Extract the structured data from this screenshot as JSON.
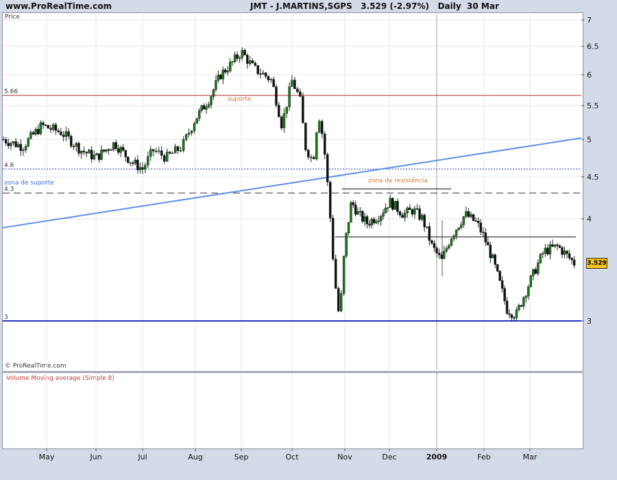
{
  "header": {
    "site": "www.ProRealTime.com",
    "symbol": "JMT - J.MARTINS,SGPS",
    "last_price": "3.529",
    "change": "(-2.97%)",
    "period": "Daily",
    "date": "30 Mar"
  },
  "panel": {
    "price_label": "Price",
    "copyright": "© ProRealTime.com",
    "volume_label": "Volume Moving average (Simple 8)"
  },
  "colors": {
    "up": "#1a7a1a",
    "down": "#111111",
    "support_red": "#b22222",
    "trendline": "#5b8fe8",
    "base_line": "#2233bb",
    "annotation_orange": "#d4782a",
    "annotation_blue": "#3c6fd9",
    "price_box": "#f2c21a"
  },
  "chart_data": {
    "type": "candlestick",
    "y_axis": {
      "ticks": [
        7,
        6.5,
        6,
        5.5,
        5,
        4.5,
        4,
        3
      ],
      "tick_labels": [
        "7",
        "6.5",
        "6",
        "5.5",
        "5",
        "4.5",
        "4",
        "3"
      ],
      "range": [
        2.6,
        7.1
      ],
      "scale": "log"
    },
    "x_axis": {
      "labels": [
        "May",
        "Jun",
        "Jul",
        "Aug",
        "Sep",
        "Oct",
        "Nov",
        "Dec",
        "2009",
        "Feb",
        "Mar"
      ],
      "range": [
        "2008-05",
        "2009-03"
      ]
    },
    "current_price_label": "3.529",
    "series": [
      {
        "x": [
          "2008-04",
          "2008-05",
          "2008-06",
          "2008-07",
          "2008-08",
          "2008-09",
          "2008-10",
          "2008-10b",
          "2008-11",
          "2008-12",
          "2009-01",
          "2009-02",
          "2009-03"
        ],
        "values": [
          4.95,
          5.15,
          4.7,
          4.6,
          5.55,
          6.3,
          5.8,
          3.2,
          3.95,
          4.05,
          3.6,
          3.05,
          3.6
        ]
      }
    ],
    "horizontal_lines": [
      {
        "label": "5.66",
        "value": 5.66,
        "style": "solid"
      },
      {
        "label": "4.6",
        "value": 4.6,
        "style": "dotted"
      },
      {
        "label": "4.3",
        "value": 4.3,
        "style": "dashed"
      },
      {
        "label": "3",
        "value": 3,
        "style": "solid"
      }
    ],
    "trendline": {
      "from": [
        "2008-04",
        3.9
      ],
      "to": [
        "2009-04",
        5.02
      ]
    },
    "annotations": {
      "support": "suporte",
      "support_zone": "zona de suporte",
      "resistance_zone": "zona de resistência"
    },
    "grid": true
  }
}
